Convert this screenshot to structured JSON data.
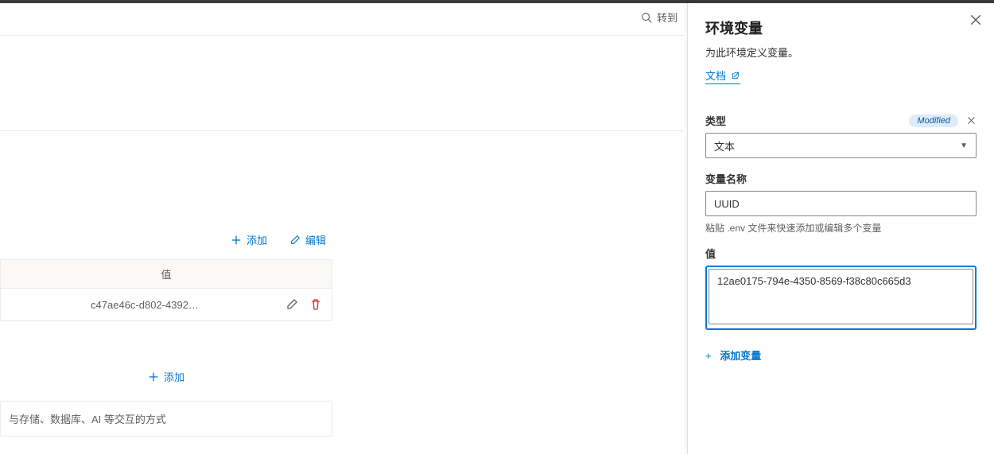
{
  "search": {
    "placeholder": "转到"
  },
  "toolbar": {
    "add": "添加",
    "edit": "编辑"
  },
  "table": {
    "header": "值",
    "rows": [
      {
        "value": "c47ae46c-d802-4392…"
      }
    ]
  },
  "section": {
    "add": "添加"
  },
  "description": "与存储、数据库、AI 等交互的方式",
  "panel": {
    "title": "环境变量",
    "subtitle": "为此环境定义变量。",
    "docs": "文档",
    "type_label": "类型",
    "badge": "Modified",
    "type_value": "文本",
    "name_label": "变量名称",
    "name_value": "UUID",
    "hint": "粘贴 .env 文件来快速添加或编辑多个变量",
    "value_label": "值",
    "value_value": "12ae0175-794e-4350-8569-f38c80c665d3",
    "add_var": "添加变量"
  }
}
